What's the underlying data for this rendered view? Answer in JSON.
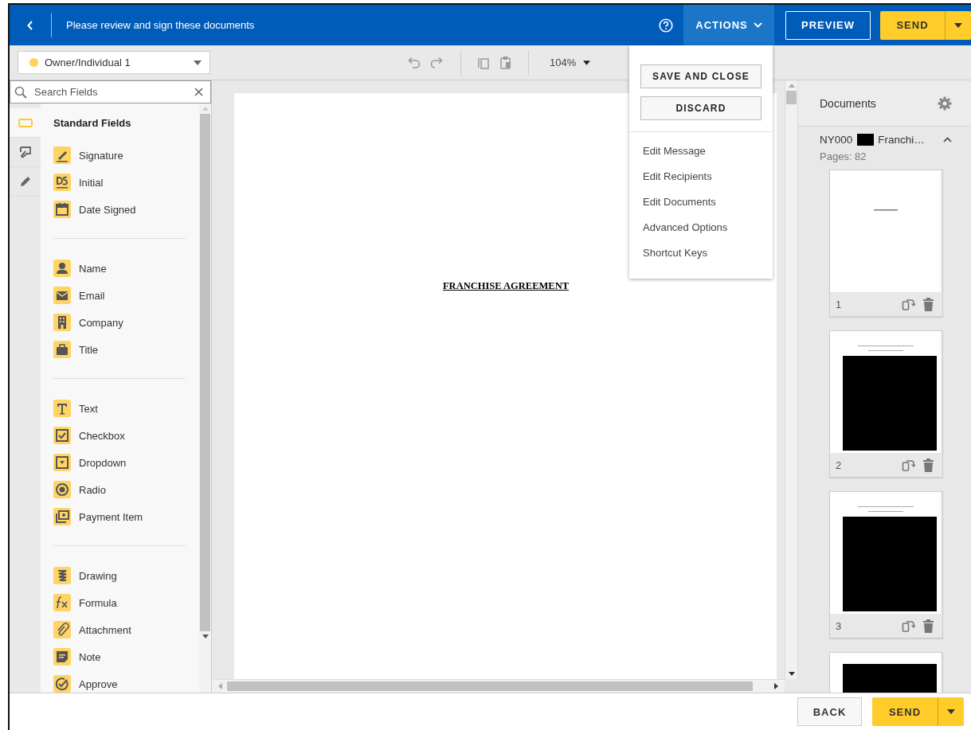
{
  "header": {
    "title": "Please review and sign these documents",
    "actions": {
      "label": "ACTIONS",
      "expanded": true
    },
    "preview": "PREVIEW",
    "send": "SEND"
  },
  "toolbar": {
    "recipient": {
      "name": "Owner/Individual 1",
      "color": "#ffd05a"
    },
    "zoom": "104%"
  },
  "actions_menu": {
    "buttons": [
      "SAVE AND CLOSE",
      "DISCARD"
    ],
    "items": [
      "Edit Message",
      "Edit Recipients",
      "Edit Documents",
      "Advanced Options",
      "Shortcut Keys"
    ]
  },
  "left_panel": {
    "tabs": [
      {
        "kind": "fields",
        "selected": true
      },
      {
        "kind": "tools",
        "selected": false
      },
      {
        "kind": "pen",
        "selected": false
      }
    ],
    "search": {
      "placeholder": "Search Fields"
    },
    "section_title": "Standard Fields",
    "groups": [
      [
        {
          "kind": "signature",
          "label": "Signature"
        },
        {
          "kind": "initial",
          "label": "Initial"
        },
        {
          "kind": "date",
          "label": "Date Signed"
        }
      ],
      [
        {
          "kind": "name",
          "label": "Name"
        },
        {
          "kind": "email",
          "label": "Email"
        },
        {
          "kind": "company",
          "label": "Company"
        },
        {
          "kind": "title",
          "label": "Title"
        }
      ],
      [
        {
          "kind": "text",
          "label": "Text"
        },
        {
          "kind": "checkbox",
          "label": "Checkbox"
        },
        {
          "kind": "dropdown",
          "label": "Dropdown"
        },
        {
          "kind": "radio",
          "label": "Radio"
        },
        {
          "kind": "payment",
          "label": "Payment Item"
        }
      ],
      [
        {
          "kind": "drawing",
          "label": "Drawing"
        },
        {
          "kind": "formula",
          "label": "Formula"
        },
        {
          "kind": "attachment",
          "label": "Attachment"
        },
        {
          "kind": "note",
          "label": "Note"
        },
        {
          "kind": "approve",
          "label": "Approve"
        }
      ]
    ]
  },
  "document": {
    "heading": "FRANCHISE AGREEMENT"
  },
  "documents_panel": {
    "title": "Documents",
    "file": {
      "prefix": "NY000",
      "name": "Franchi…",
      "expanded": true,
      "pages": "Pages: 82"
    },
    "thumbnails": [
      {
        "kind": "title",
        "number": "1"
      },
      {
        "kind": "redacted",
        "number": "2"
      },
      {
        "kind": "redacted",
        "number": "3"
      },
      {
        "kind": "redacted_cut"
      }
    ]
  },
  "footer": {
    "back": "BACK",
    "send": "SEND"
  }
}
